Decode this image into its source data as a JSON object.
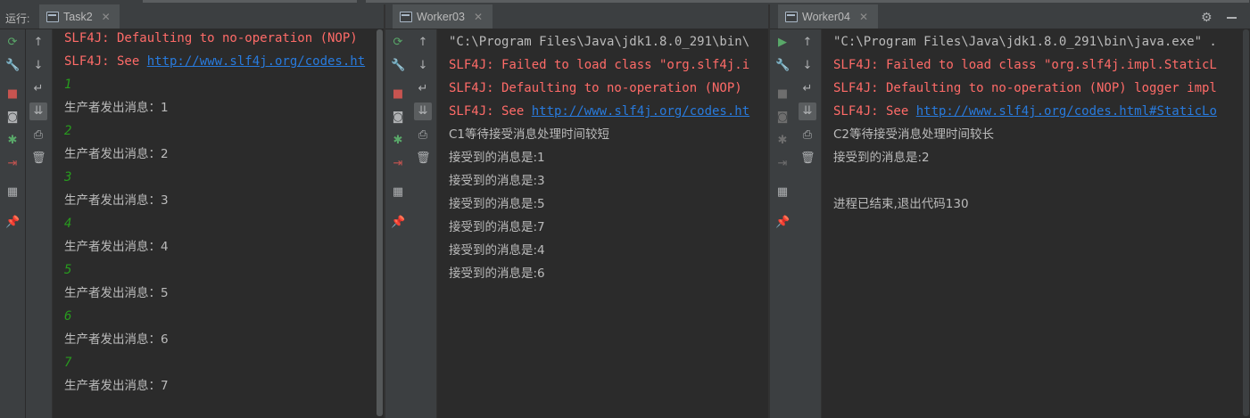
{
  "run_label": "运行:",
  "panels": [
    {
      "tab_title": "Task2",
      "lines": [
        {
          "text": "SLF4J: Defaulting to no-operation (NOP)",
          "kind": "err"
        },
        {
          "prefix": "SLF4J: See ",
          "link": "http://www.slf4j.org/codes.ht",
          "kind": "err-link"
        },
        {
          "text": "1",
          "kind": "num"
        },
        {
          "text": "生产者发出消息：1",
          "kind": "cjk"
        },
        {
          "text": "2",
          "kind": "num"
        },
        {
          "text": "生产者发出消息：2",
          "kind": "cjk"
        },
        {
          "text": "3",
          "kind": "num"
        },
        {
          "text": "生产者发出消息：3",
          "kind": "cjk"
        },
        {
          "text": "4",
          "kind": "num"
        },
        {
          "text": "生产者发出消息：4",
          "kind": "cjk"
        },
        {
          "text": "5",
          "kind": "num"
        },
        {
          "text": "生产者发出消息：5",
          "kind": "cjk"
        },
        {
          "text": "6",
          "kind": "num"
        },
        {
          "text": "生产者发出消息：6",
          "kind": "cjk"
        },
        {
          "text": "7",
          "kind": "num"
        },
        {
          "text": "生产者发出消息：7",
          "kind": "cjk"
        }
      ]
    },
    {
      "tab_title": "Worker03",
      "lines": [
        {
          "text": "\"C:\\Program Files\\Java\\jdk1.8.0_291\\bin\\",
          "kind": "gray"
        },
        {
          "text": "SLF4J: Failed to load class \"org.slf4j.i",
          "kind": "err"
        },
        {
          "text": "SLF4J: Defaulting to no-operation (NOP)",
          "kind": "err"
        },
        {
          "prefix": "SLF4J: See ",
          "link": "http://www.slf4j.org/codes.ht",
          "kind": "err-link"
        },
        {
          "text": "C1等待接受消息处理时间较短",
          "kind": "cjk"
        },
        {
          "text": "接受到的消息是:1",
          "kind": "cjk"
        },
        {
          "text": "接受到的消息是:3",
          "kind": "cjk"
        },
        {
          "text": "接受到的消息是:5",
          "kind": "cjk"
        },
        {
          "text": "接受到的消息是:7",
          "kind": "cjk"
        },
        {
          "text": "接受到的消息是:4",
          "kind": "cjk"
        },
        {
          "text": "接受到的消息是:6",
          "kind": "cjk"
        }
      ]
    },
    {
      "tab_title": "Worker04",
      "lines": [
        {
          "text": "\"C:\\Program Files\\Java\\jdk1.8.0_291\\bin\\java.exe\" .",
          "kind": "gray"
        },
        {
          "text": "SLF4J: Failed to load class \"org.slf4j.impl.StaticL",
          "kind": "err"
        },
        {
          "text": "SLF4J: Defaulting to no-operation (NOP) logger impl",
          "kind": "err"
        },
        {
          "prefix": "SLF4J: See ",
          "link": "http://www.slf4j.org/codes.html#StaticLo",
          "kind": "err-link"
        },
        {
          "text": "C2等待接受消息处理时间较长",
          "kind": "cjk"
        },
        {
          "text": "接受到的消息是:2",
          "kind": "cjk"
        },
        {
          "text": "",
          "kind": "blank"
        },
        {
          "text": "进程已结束,退出代码130",
          "kind": "cjk"
        }
      ]
    }
  ],
  "icons": {
    "left": [
      "rerun-icon",
      "wrench-icon",
      "stop-icon",
      "camera-icon",
      "debug-icon",
      "exit-icon",
      "layout-icon",
      "pin-icon"
    ],
    "console": [
      "up-arrow-icon",
      "down-arrow-icon",
      "soft-wrap-icon",
      "scroll-to-end-icon",
      "print-icon",
      "trash-icon"
    ]
  },
  "colors": {
    "background": "#2b2b2b",
    "error": "#ff6b68",
    "link": "#287bde",
    "number": "#289c1e",
    "text": "#bbbbbb"
  }
}
